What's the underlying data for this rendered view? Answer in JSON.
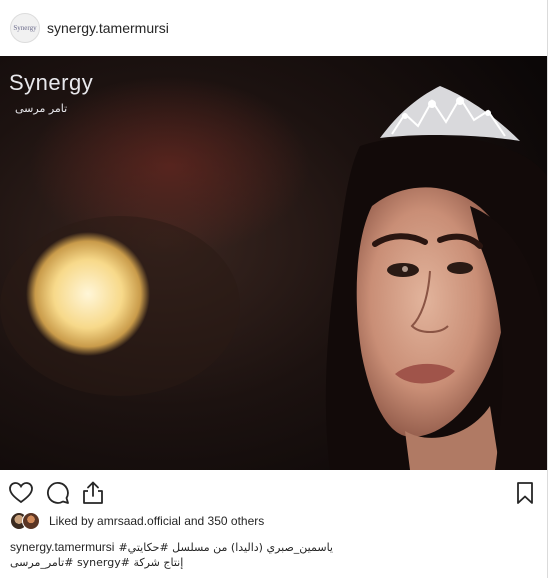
{
  "header": {
    "avatar_text": "Synergy",
    "username": "synergy.tamermursi"
  },
  "photo": {
    "logo_main": "Synergy",
    "logo_sub": "تامر مرسى",
    "description_icon": "portrait-photo"
  },
  "actions": {
    "like_icon": "heart-icon",
    "comment_icon": "comment-icon",
    "share_icon": "share-icon",
    "save_icon": "bookmark-icon"
  },
  "likes": {
    "prefix": "Liked by ",
    "user": "amrsaad.official",
    "suffix": " and 350 others"
  },
  "caption": {
    "user": "synergy.tamermursi",
    "line1": "ياسمين_صبري (داليدا) من مسلسل #حكايتي#",
    "line2": "إنتاج شركة #synergy #تامر_مرسى"
  },
  "colors": {
    "text": "#262626",
    "hashtag": "#003569",
    "border": "#dbdbdb"
  }
}
